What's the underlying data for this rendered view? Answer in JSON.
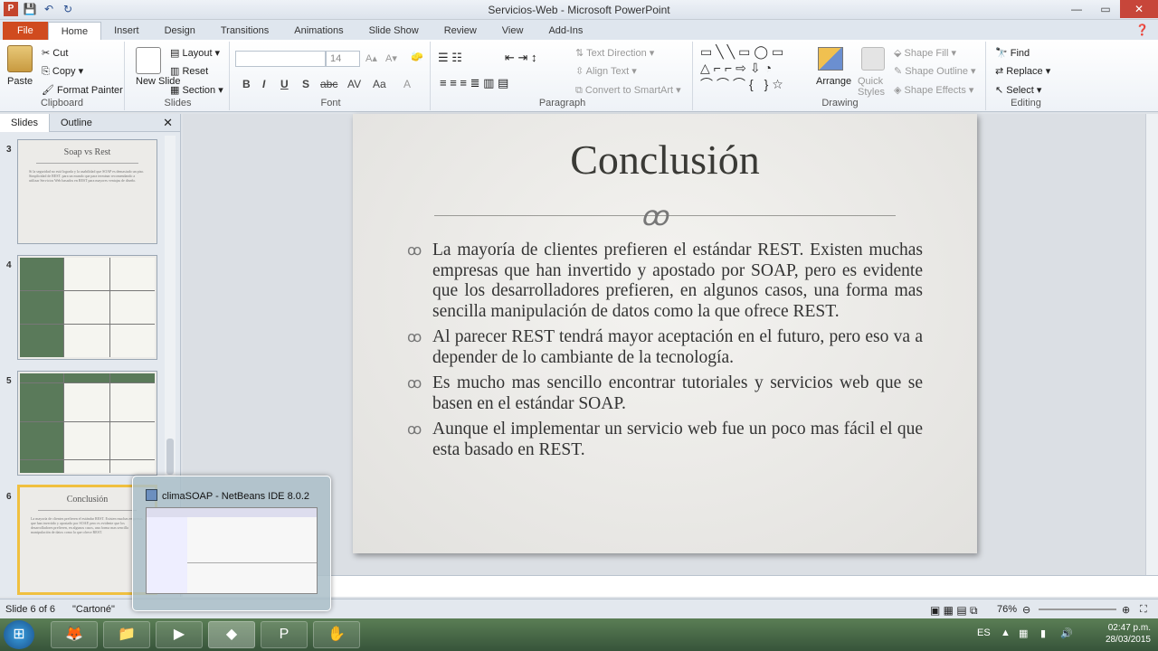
{
  "window": {
    "title": "Servicios-Web - Microsoft PowerPoint"
  },
  "tabs": [
    "File",
    "Home",
    "Insert",
    "Design",
    "Transitions",
    "Animations",
    "Slide Show",
    "Review",
    "View",
    "Add-Ins"
  ],
  "ribbon": {
    "clipboard": {
      "label": "Clipboard",
      "paste": "Paste",
      "cut": "Cut",
      "copy": "Copy",
      "format_painter": "Format Painter"
    },
    "slides": {
      "label": "Slides",
      "new_slide": "New Slide",
      "layout": "Layout",
      "reset": "Reset",
      "section": "Section"
    },
    "font": {
      "label": "Font",
      "size": "14"
    },
    "paragraph": {
      "label": "Paragraph",
      "text_direction": "Text Direction",
      "align_text": "Align Text",
      "smartart": "Convert to SmartArt"
    },
    "drawing": {
      "label": "Drawing",
      "arrange": "Arrange",
      "quick_styles": "Quick Styles",
      "shape_fill": "Shape Fill",
      "shape_outline": "Shape Outline",
      "shape_effects": "Shape Effects"
    },
    "editing": {
      "label": "Editing",
      "find": "Find",
      "replace": "Replace",
      "select": "Select"
    }
  },
  "panel": {
    "tab_slides": "Slides",
    "tab_outline": "Outline"
  },
  "thumbnails": {
    "t3": {
      "num": "3",
      "title": "Soap vs Rest",
      "text": "Si la seguridad no está lograda y la usabilidad que SOAP es demasiado un piso. Simplicidad de REST. para un mundo que para terminar recomendando a utilizar Servicios Web basados en REST para mayores ventajas de diseño."
    },
    "t4": {
      "num": "4"
    },
    "t5": {
      "num": "5"
    },
    "t6": {
      "num": "6",
      "title": "Conclusión",
      "text": "La mayoría de clientes prefieren el estándar REST. Existen muchas empresas que han invertido y apostado por SOAP, pero es evidente que los desarrolladores prefieren, en algunos casos, una forma mas sencilla manipulación de datos como la que ofrece REST."
    }
  },
  "slide": {
    "title": "Conclusión",
    "bullets": [
      "La mayoría de  clientes prefieren el estándar REST. Existen muchas empresas que han invertido y apostado por SOAP, pero es evidente que los desarrolladores prefieren, en algunos casos, una forma mas sencilla manipulación de datos como la que ofrece REST.",
      "Al parecer REST tendrá mayor aceptación en el futuro, pero eso va a depender de lo cambiante de la tecnología.",
      "Es mucho mas sencillo encontrar tutoriales y servicios web que se basen en el estándar SOAP.",
      "Aunque el implementar un servicio web fue un poco mas fácil el que esta basado en REST."
    ]
  },
  "status": {
    "slide": "Slide 6 of 6",
    "theme": "\"Cartoné\"",
    "zoom": "76%"
  },
  "preview": {
    "title": "climaSOAP - NetBeans IDE 8.0.2"
  },
  "tray": {
    "lang": "ES",
    "time": "02:47 p.m.",
    "date": "28/03/2015"
  },
  "colors": {
    "file_tab": "#d04b1f",
    "selected_thumb": "#f0c040",
    "taskbar": "#4a6b45"
  }
}
